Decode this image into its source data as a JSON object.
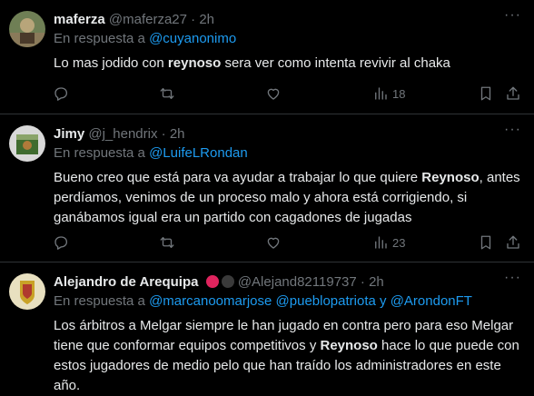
{
  "tweets": [
    {
      "name": "maferza",
      "handle": "@maferza27",
      "sep": "·",
      "time": "2h",
      "reply_prefix": "En respuesta a",
      "reply_to": "@cuyanonimo",
      "body_pre": "Lo mas jodido con ",
      "body_bold": "reynoso",
      "body_post": " sera ver como intenta revivir al chaka",
      "views": "18",
      "avatar_color": "#7a8a5a"
    },
    {
      "name": "Jimy",
      "handle": "@j_hendrix",
      "sep": "·",
      "time": "2h",
      "reply_prefix": "En respuesta a",
      "reply_to": "@LuifeLRondan",
      "body_pre": "Bueno creo que está para va ayudar a trabajar lo que quiere ",
      "body_bold": "Reynoso",
      "body_post": ", antes perdíamos, venimos de un proceso malo y ahora está corrigiendo, si ganábamos igual era un partido con cagadones de jugadas",
      "views": "23",
      "avatar_color": "#5a7a4a"
    },
    {
      "name": "Alejandro de Arequipa",
      "handle": "@Alejand82119737",
      "sep": "·",
      "time": "2h",
      "reply_prefix": "En respuesta a",
      "reply_to_1": "@marcanoomarjose",
      "reply_to_2": "@pueblopatriota",
      "reply_and": "y",
      "reply_to_3": "@ArondonFT",
      "body_pre": "Los árbitros a Melgar siempre le han jugado en contra pero para eso Melgar tiene que conformar equipos competitivos y ",
      "body_bold": "Reynoso",
      "body_post": " hace lo que puede con estos jugadores de medio pelo que han traído los administradores en este año.",
      "avatar_color": "#c9a227"
    }
  ],
  "icons": [
    "reply-icon",
    "retweet-icon",
    "like-icon",
    "views-icon",
    "bookmark-icon",
    "share-icon",
    "more-icon"
  ]
}
